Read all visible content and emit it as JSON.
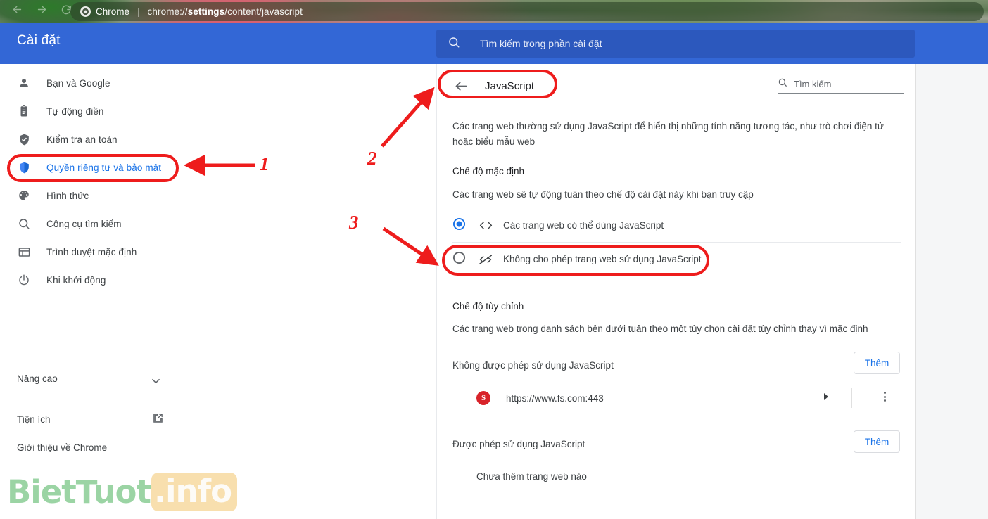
{
  "browser": {
    "back_icon": "back-arrow-icon",
    "forward_icon": "forward-arrow-icon",
    "reload_icon": "reload-icon",
    "chrome_label": "Chrome",
    "url_prefix": "chrome://",
    "url_bold": "settings",
    "url_suffix": "/content/javascript",
    "full_url": "chrome://settings/content/javascript"
  },
  "header": {
    "title": "Cài đặt",
    "search_placeholder": "Tìm kiếm trong phần cài đặt",
    "accent": "#3367d6",
    "search_bg": "#2c58bd"
  },
  "sidebar": {
    "items": [
      {
        "label": "Bạn và Google",
        "icon": "person-icon",
        "selected": false
      },
      {
        "label": "Tự động điền",
        "icon": "clipboard-icon",
        "selected": false
      },
      {
        "label": "Kiểm tra an toàn",
        "icon": "shield-check-icon",
        "selected": false
      },
      {
        "label": "Quyền riêng tư và bảo mật",
        "icon": "shield-icon",
        "selected": true
      },
      {
        "label": "Hình thức",
        "icon": "palette-icon",
        "selected": false
      },
      {
        "label": "Công cụ tìm kiếm",
        "icon": "search-icon",
        "selected": false
      },
      {
        "label": "Trình duyệt mặc định",
        "icon": "browser-window-icon",
        "selected": false
      },
      {
        "label": "Khi khởi động",
        "icon": "power-icon",
        "selected": false
      }
    ],
    "advanced_label": "Nâng cao",
    "advanced_icon": "chevron-down-icon",
    "extensions_label": "Tiện ích",
    "extensions_icon": "external-link-icon",
    "about_label": "Giới thiệu về Chrome",
    "selected_color": "#1a73e8"
  },
  "content": {
    "back_icon": "back-arrow-icon",
    "page_title": "JavaScript",
    "search_icon": "search-icon",
    "search_placeholder": "Tìm kiếm",
    "description": "Các trang web thường sử dụng JavaScript để hiển thị những tính năng tương tác, như trò chơi điện tử hoặc biểu mẫu web",
    "default_section": {
      "title": "Chế độ mặc định",
      "subtitle": "Các trang web sẽ tự động tuân theo chế độ cài đặt này khi bạn truy cập",
      "options": [
        {
          "label": "Các trang web có thể dùng JavaScript",
          "icon": "code-icon",
          "selected": true
        },
        {
          "label": "Không cho phép trang web sử dụng JavaScript",
          "icon": "code-off-icon",
          "selected": false
        }
      ]
    },
    "custom_section": {
      "title": "Chế độ tùy chỉnh",
      "subtitle": "Các trang web trong danh sách bên dưới tuân theo một tùy chọn cài đặt tùy chỉnh thay vì mặc định",
      "blocked": {
        "label": "Không được phép sử dụng JavaScript",
        "add_label": "Thêm",
        "sites": [
          {
            "url": "https://www.fs.com:443",
            "favicon_letter": "S",
            "favicon_color": "#d8232a",
            "expand_icon": "chevron-right-icon",
            "menu_icon": "more-vertical-icon"
          }
        ]
      },
      "allowed": {
        "label": "Được phép sử dụng JavaScript",
        "add_label": "Thêm",
        "empty_text": "Chưa thêm trang web nào"
      }
    }
  },
  "annotations": {
    "color": "#ee1c1c",
    "steps": [
      {
        "number": "1",
        "target": "sidebar-item-privacy-security"
      },
      {
        "number": "2",
        "target": "javascript-back-header"
      },
      {
        "number": "3",
        "target": "radio-option-block-javascript"
      }
    ]
  },
  "watermark": {
    "name": "BietTuot",
    "suffix": ".info"
  }
}
